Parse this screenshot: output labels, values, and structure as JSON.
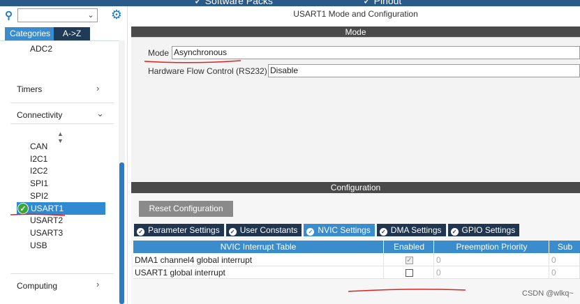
{
  "topbar": {
    "software_packs": "✓ Software Packs",
    "pinout": "✓ Pinout"
  },
  "sidebar": {
    "search_value": "",
    "tabs": {
      "categories": "Categories",
      "az": "A->Z"
    },
    "adc_item": "ADC2",
    "categories": {
      "timers": "Timers",
      "connectivity": "Connectivity",
      "computing": "Computing"
    },
    "connectivity_items": [
      "CAN",
      "I2C1",
      "I2C2",
      "SPI1",
      "SPI2",
      "USART1",
      "USART2",
      "USART3",
      "USB"
    ],
    "selected": "USART1"
  },
  "main": {
    "title": "USART1 Mode and Configuration",
    "mode_header": "Mode",
    "mode_label": "Mode",
    "mode_value": "Asynchronous",
    "flow_label": "Hardware Flow Control (RS232)",
    "flow_value": "Disable",
    "config_header": "Configuration",
    "reset_button": "Reset Configuration",
    "tabs": [
      "Parameter Settings",
      "User Constants",
      "NVIC Settings",
      "DMA Settings",
      "GPIO Settings"
    ],
    "active_tab": "NVIC Settings",
    "table": {
      "headers": [
        "NVIC Interrupt Table",
        "Enabled",
        "Preemption Priority",
        "Sub"
      ],
      "rows": [
        {
          "name": "DMA1 channel4 global interrupt",
          "enabled": true,
          "preemption": "0",
          "sub": "0"
        },
        {
          "name": "USART1 global interrupt",
          "enabled": false,
          "preemption": "0",
          "sub": "0"
        }
      ]
    }
  },
  "watermark": "CSDN @wlkq~",
  "colors": {
    "accent": "#3a8ccd",
    "dark_tab": "#1f3550",
    "header_gray": "#4a4a4a",
    "annotation_red": "#e02020"
  }
}
